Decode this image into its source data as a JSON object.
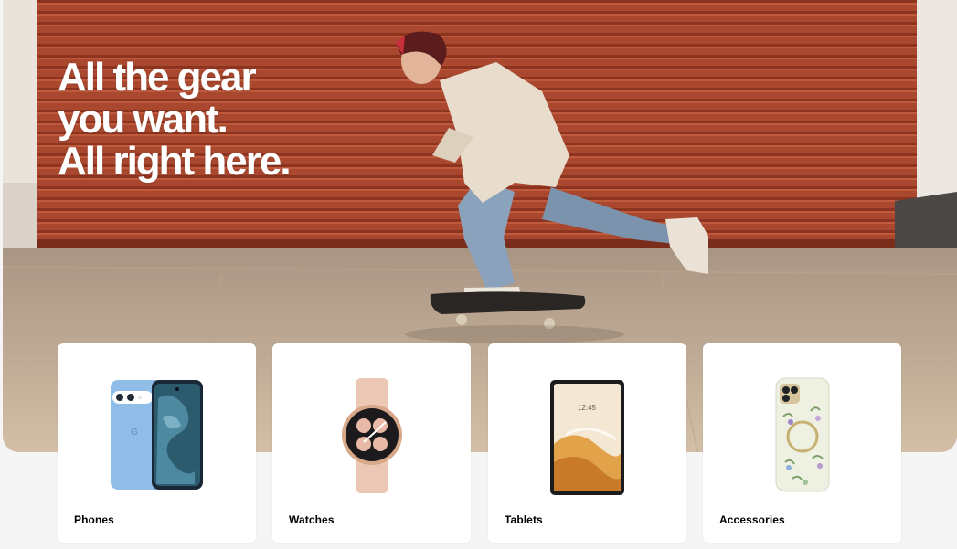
{
  "hero": {
    "headline_lines": [
      "All the gear",
      "you want.",
      "All right here."
    ],
    "colors": {
      "shutter": "#a8472e",
      "pavement": "#c4ab90",
      "headline": "#ffffff"
    }
  },
  "categories": [
    {
      "label": "Phones",
      "icon": "phone-icon"
    },
    {
      "label": "Watches",
      "icon": "watch-icon"
    },
    {
      "label": "Tablets",
      "icon": "tablet-icon"
    },
    {
      "label": "Accessories",
      "icon": "phone-case-icon"
    }
  ],
  "tablet_screen": {
    "time": "12:45"
  }
}
